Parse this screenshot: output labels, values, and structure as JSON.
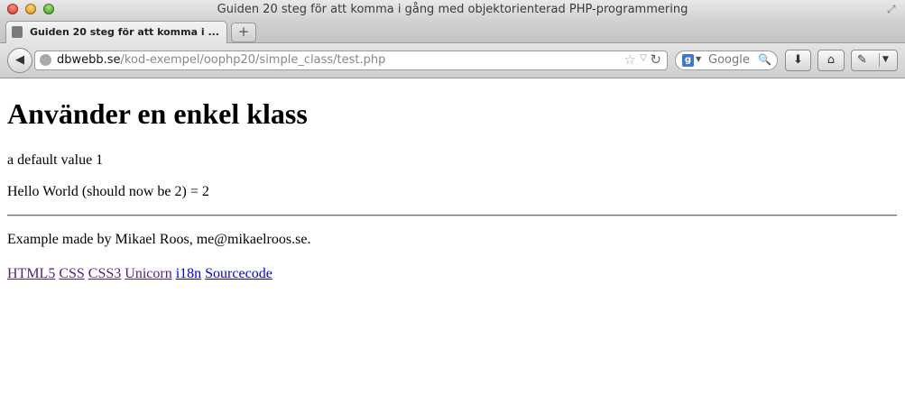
{
  "window": {
    "title": "Guiden 20 steg för att komma i gång med objektorienterad PHP-programmering"
  },
  "tabs": [
    {
      "label": "Guiden 20 steg för att komma i ..."
    }
  ],
  "new_tab_label": "+",
  "navbar": {
    "url_host": "dbwebb.se",
    "url_path": "/kod-exempel/oophp20/simple_class/test.php",
    "search_placeholder": "Google"
  },
  "page": {
    "heading": "Använder en enkel klass",
    "line1": "a default value 1",
    "line2": "Hello World (should now be 2) = 2",
    "footer_text": "Example made by Mikael Roos, me@mikaelroos.se.",
    "links": [
      "HTML5",
      "CSS",
      "CSS3",
      "Unicorn",
      "i18n",
      "Sourcecode"
    ]
  },
  "colors": {
    "visited_link": "#551a8b",
    "unvisited_link": "#0000ee"
  }
}
